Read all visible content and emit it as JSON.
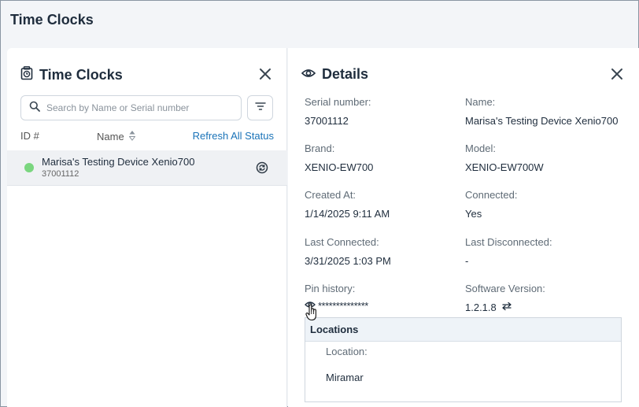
{
  "page": {
    "title": "Time Clocks"
  },
  "left_panel": {
    "title": "Time Clocks",
    "search_placeholder": "Search by Name or Serial number",
    "columns": {
      "id": "ID #",
      "name": "Name",
      "refresh": "Refresh All Status"
    },
    "devices": [
      {
        "name": "Marisa's Testing Device Xenio700",
        "serial": "37001112",
        "status": "online"
      }
    ]
  },
  "details": {
    "title": "Details",
    "serial_label": "Serial number:",
    "serial_value": "37001112",
    "name_label": "Name:",
    "name_value": "Marisa's Testing Device Xenio700",
    "brand_label": "Brand:",
    "brand_value": "XENIO-EW700",
    "model_label": "Model:",
    "model_value": "XENIO-EW700W",
    "created_label": "Created At:",
    "created_value": "1/14/2025 9:11 AM",
    "connected_label": "Connected:",
    "connected_value": "Yes",
    "last_connected_label": "Last Connected:",
    "last_connected_value": "3/31/2025 1:03 PM",
    "last_disconnected_label": "Last Disconnected:",
    "last_disconnected_value": "-",
    "pin_label": "Pin history:",
    "pin_value": "**************",
    "software_label": "Software Version:",
    "software_value": "1.2.1.8",
    "locations": {
      "header": "Locations",
      "location_label": "Location:",
      "location_value": "Miramar"
    }
  },
  "colors": {
    "accent_link": "#1a73b8",
    "status_online": "#7ad67f",
    "title_text": "#1f2d3d"
  },
  "icons": [
    "time-clock-icon",
    "close-icon",
    "search-icon",
    "filter-icon",
    "sort-icon",
    "sync-icon",
    "eye-icon",
    "swap-arrows-icon",
    "hand-cursor-icon"
  ]
}
